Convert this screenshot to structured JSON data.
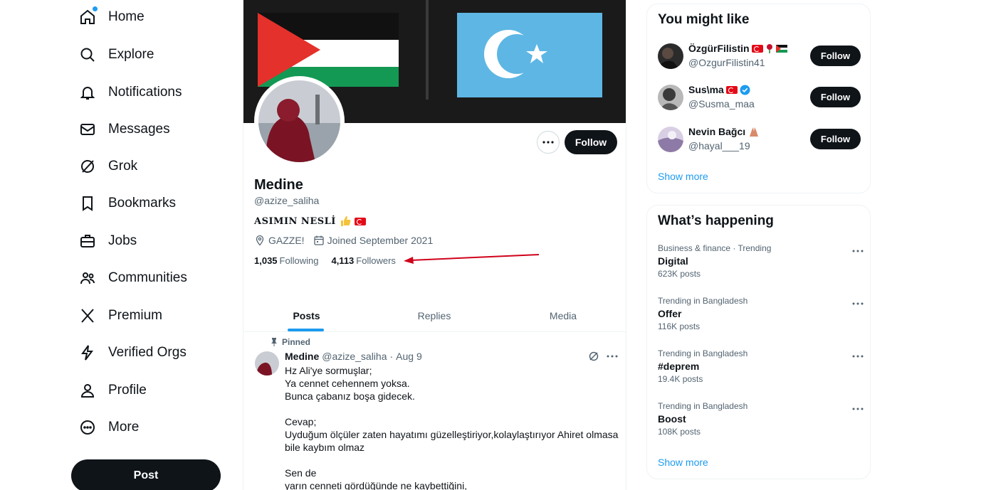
{
  "nav": {
    "items": [
      {
        "label": "Home",
        "icon": "home-icon"
      },
      {
        "label": "Explore",
        "icon": "search-icon"
      },
      {
        "label": "Notifications",
        "icon": "bell-icon"
      },
      {
        "label": "Messages",
        "icon": "mail-icon"
      },
      {
        "label": "Grok",
        "icon": "grok-icon"
      },
      {
        "label": "Bookmarks",
        "icon": "bookmark-icon"
      },
      {
        "label": "Jobs",
        "icon": "briefcase-icon"
      },
      {
        "label": "Communities",
        "icon": "people-icon"
      },
      {
        "label": "Premium",
        "icon": "x-logo-icon"
      },
      {
        "label": "Verified Orgs",
        "icon": "lightning-icon"
      },
      {
        "label": "Profile",
        "icon": "person-icon"
      },
      {
        "label": "More",
        "icon": "more-circle-icon"
      }
    ],
    "post_button": "Post"
  },
  "profile": {
    "name": "Medine",
    "handle": "@azize_saliha",
    "bio": "ASIMIN NESLİ",
    "location": "GAZZE!",
    "joined": "Joined September 2021",
    "following_count": "1,035",
    "following_label": "Following",
    "followers_count": "4,113",
    "followers_label": "Followers",
    "follow_button": "Follow"
  },
  "tabs": [
    {
      "label": "Posts",
      "active": true
    },
    {
      "label": "Replies",
      "active": false
    },
    {
      "label": "Media",
      "active": false
    }
  ],
  "post": {
    "pinned_label": "Pinned",
    "author": "Medine",
    "handle": "@azize_saliha",
    "separator": "·",
    "date": "Aug 9",
    "body_lines": [
      "Hz Ali'ye sormuşlar;\nYa cennet cehennem yoksa.\nBunca çabanız boşa gidecek.",
      "Cevap;\nUyduğum ölçüler zaten hayatımı güzelleştiriyor,kolaylaştırıyor Ahiret olmasa bile kaybım olmaz",
      "Sen de\nyarın cenneti gördüğünde ne kaybettiğini,"
    ]
  },
  "you_might_like": {
    "title": "You might like",
    "users": [
      {
        "name": "ÖzgürFilistin",
        "handle": "@OzgurFilistin41",
        "button": "Follow"
      },
      {
        "name": "Sus\\ma",
        "handle": "@Susma_maa",
        "button": "Follow"
      },
      {
        "name": "Nevin Bağcı",
        "handle": "@hayal___19",
        "button": "Follow"
      }
    ],
    "show_more": "Show more"
  },
  "whats_happening": {
    "title": "What’s happening",
    "trends": [
      {
        "context": "Business & finance · Trending",
        "name": "Digital",
        "count": "623K posts"
      },
      {
        "context": "Trending in Bangladesh",
        "name": "Offer",
        "count": "116K posts"
      },
      {
        "context": "Trending in Bangladesh",
        "name": "#deprem",
        "count": "19.4K posts"
      },
      {
        "context": "Trending in Bangladesh",
        "name": "Boost",
        "count": "108K posts"
      }
    ],
    "show_more": "Show more"
  },
  "colors": {
    "accent": "#1d9bf0",
    "text": "#0f1419",
    "secondary": "#536471",
    "button": "#0f1419",
    "annotation_arrow": "#d0021b"
  }
}
